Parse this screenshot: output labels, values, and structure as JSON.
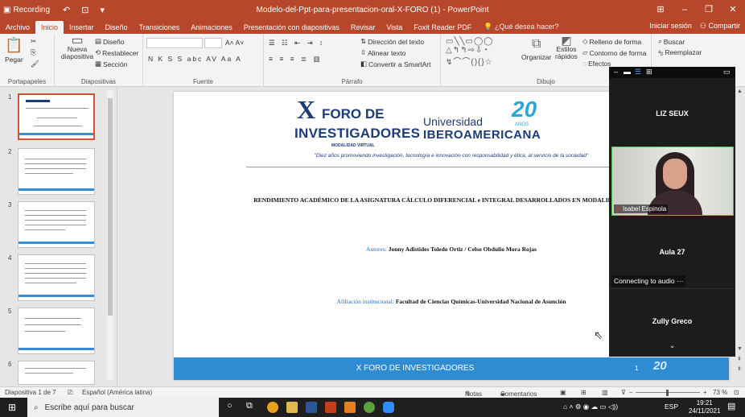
{
  "titlebar": {
    "app": "Recording",
    "document_title": "Modelo-del-Ppt-para-presentacion-oral-X-FORO (1) - PowerPoint"
  },
  "tabs": [
    "Archivo",
    "Inicio",
    "Insertar",
    "Diseño",
    "Transiciones",
    "Animaciones",
    "Presentación con diapositivas",
    "Revisar",
    "Vista",
    "Foxit Reader PDF"
  ],
  "active_tab": "Inicio",
  "tell_me": "¿Qué desea hacer?",
  "account": {
    "signin": "Iniciar sesión",
    "share": "Compartir"
  },
  "ribbon": {
    "portapapeles": {
      "label": "Portapapeles",
      "paste": "Pegar"
    },
    "diapositivas": {
      "label": "Diapositivas",
      "new_slide": "Nueva diapositiva",
      "layout": "Diseño",
      "reset": "Restablecer",
      "section": "Sección"
    },
    "fuente": {
      "label": "Fuente",
      "style_buttons": "N  K  S  S  abc  AV  Aa  A"
    },
    "parrafo": {
      "label": "Párrafo",
      "text_direction": "Dirección del texto",
      "align_text": "Alinear texto",
      "smartart": "Convertir a SmartArt"
    },
    "dibujo": {
      "label": "Dibujo",
      "arrange": "Organizar",
      "quick_styles": "Estilos rápidos",
      "fill": "Relleno de forma",
      "outline": "Contorno de forma",
      "effects": "Efectos"
    },
    "edicion": {
      "find": "Buscar",
      "replace": "Reemplazar"
    }
  },
  "thumbnails": [
    "1",
    "2",
    "3",
    "4",
    "5",
    "6"
  ],
  "slide": {
    "logo_x": "X",
    "logo_foro": "FORO DE",
    "logo_investigadores": "INVESTIGADORES",
    "logo_modalidad": "MODALIDAD VIRTUAL",
    "university_line1": "Universidad",
    "university_line2": "IBEROAMERICANA",
    "anniversary": "20",
    "anniversary_label": "AÑOS",
    "motto": "\"Diez años promoviendo investigación, tecnología e innovación con responsabilidad y ética, al servicio de la sociedad\"",
    "heading": "RENDIMIENTO ACADÉMICO DE LA ASIGNATURA CÁLCULO DIFERENCIAL e INTEGRAL DESARROLLADOS EN MODALIDAD PRESENCIAL y VIRTUAL",
    "authors_label": "Autores:",
    "authors_value": "Jonny Adistides Toledo Ortiz / Celso Obdulio Mora Rojas",
    "affiliation_label": "Afiliación institucional:",
    "affiliation_value": "Facultad de Ciencias Químicas-Universidad Nacional de Asunción",
    "footer": "X FORO DE INVESTIGADORES",
    "footer_number": "1",
    "footer_logo": "20"
  },
  "zoom": {
    "participants": [
      "LIZ SEUX",
      "Aula 27",
      "Zully Greco"
    ],
    "video_name": "Isabel Espinola",
    "connecting": "Connecting to audio ···"
  },
  "statusbar": {
    "slide_info": "Diapositiva 1 de 7",
    "language": "Español (América latina)",
    "notes": "Notas",
    "comments": "Comentarios",
    "zoom_level": "73 %"
  },
  "taskbar": {
    "search_placeholder": "Escribe aquí para buscar",
    "lang": "ESP",
    "time": "19:21",
    "date": "24/11/2021"
  },
  "colors": {
    "accent": "#b7472a",
    "slide_blue": "#2f8bd2",
    "navy": "#1d3b78"
  }
}
